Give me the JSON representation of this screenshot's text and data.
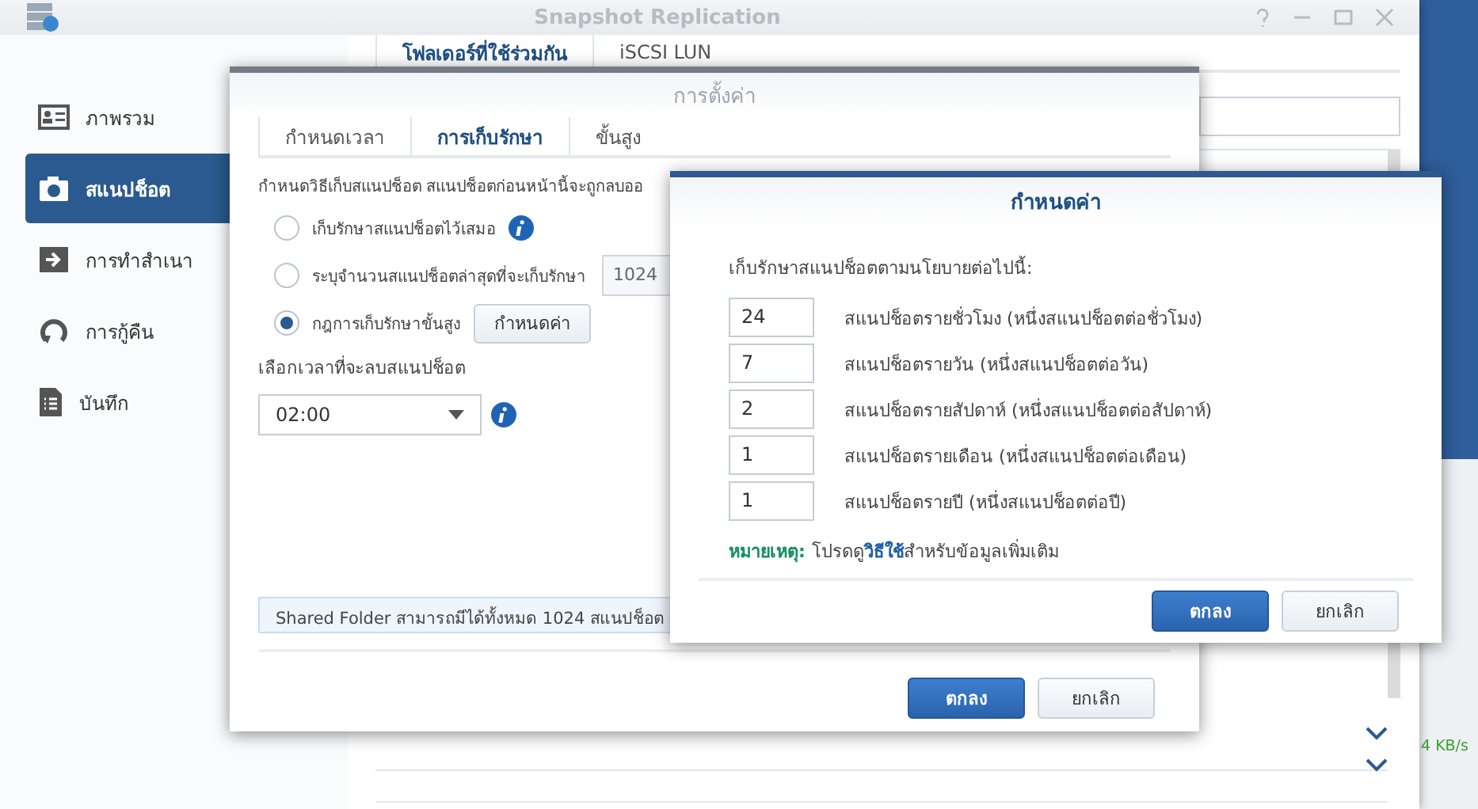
{
  "window": {
    "title": "Snapshot Replication"
  },
  "sidebar": {
    "items": [
      {
        "label": "ภาพรวม",
        "selected": false
      },
      {
        "label": "สแนปช็อต",
        "selected": true
      },
      {
        "label": "การทำสำเนา",
        "selected": false
      },
      {
        "label": "การกู้คืน",
        "selected": false
      },
      {
        "label": "บันทึก",
        "selected": false
      }
    ]
  },
  "tabs": [
    {
      "label": "โฟลเดอร์ที่ใช้ร่วมกัน",
      "selected": true
    },
    {
      "label": "iSCSI LUN",
      "selected": false
    }
  ],
  "background_window": {
    "reading": "4 KB/s"
  },
  "settings_dialog": {
    "title": "การตั้งค่า",
    "tabs": [
      {
        "label": "กำหนดเวลา",
        "selected": false
      },
      {
        "label": "การเก็บรักษา",
        "selected": true
      },
      {
        "label": "ขั้นสูง",
        "selected": false
      }
    ],
    "description": "กำหนดวิธีเก็บสแนปช็อต สแนปช็อตก่อนหน้านี้จะถูกลบออ",
    "options": [
      {
        "kind": "info",
        "label": "เก็บรักษาสแนปช็อตไว้เสมอ",
        "selected": false
      },
      {
        "kind": "field",
        "label": "ระบุจำนวนสแนปช็อตล่าสุดที่จะเก็บรักษา",
        "value": "1024",
        "selected": false
      },
      {
        "kind": "button",
        "label": "กฎการเก็บรักษาขั้นสูง",
        "button": "กำหนดค่า",
        "selected": true
      }
    ],
    "time_label": "เลือกเวลาที่จะลบสแนปช็อต",
    "time_value": "02:00",
    "info_bar": "Shared Folder สามารถมีได้ทั้งหมด 1024 สแนปช็อต",
    "buttons": [
      {
        "label": "ตกลง",
        "kind": "primary"
      },
      {
        "label": "ยกเลิก",
        "kind": "secondary"
      }
    ]
  },
  "config_dialog": {
    "title": "กำหนดค่า",
    "intro": "เก็บรักษาสแนปช็อตตามนโยบายต่อไปนี้:",
    "rows": [
      {
        "value": "24",
        "label": "สแนปช็อตรายชั่วโมง (หนึ่งสแนปช็อตต่อชั่วโมง)"
      },
      {
        "value": "7",
        "label": "สแนปช็อตรายวัน (หนึ่งสแนปช็อตต่อวัน)"
      },
      {
        "value": "2",
        "label": "สแนปช็อตรายสัปดาห์ (หนึ่งสแนปช็อตต่อสัปดาห์)"
      },
      {
        "value": "1",
        "label": "สแนปช็อตรายเดือน (หนึ่งสแนปช็อตต่อเดือน)"
      },
      {
        "value": "1",
        "label": "สแนปช็อตรายปี (หนึ่งสแนปช็อตต่อปี)"
      }
    ],
    "note": {
      "label": "หมายเหตุ:",
      "before": "โปรดดู",
      "link": "วิธีใช้",
      "after": "สำหรับข้อมูลเพิ่มเติม"
    },
    "buttons": [
      {
        "label": "ตกลง",
        "kind": "primary"
      },
      {
        "label": "ยกเลิก",
        "kind": "secondary"
      }
    ]
  }
}
